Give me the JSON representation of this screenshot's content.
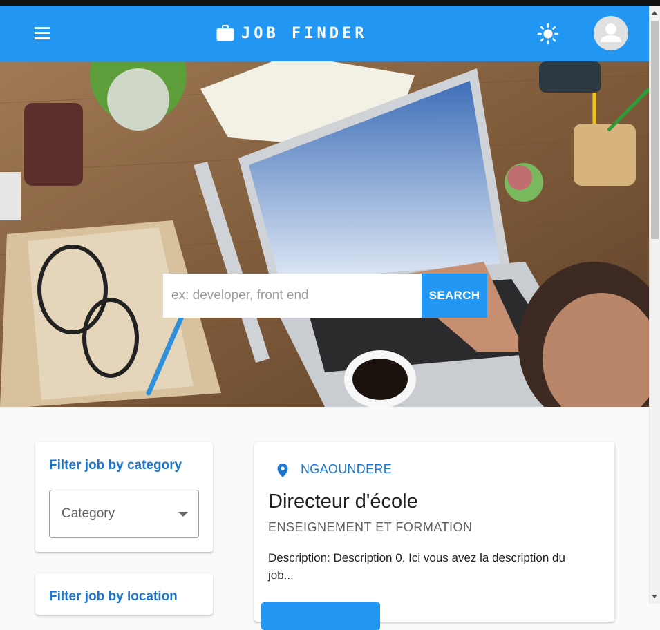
{
  "header": {
    "menu_icon": "menu-icon",
    "brand_icon": "briefcase-icon",
    "title": "JOB FINDER",
    "theme_icon": "sun-icon",
    "avatar_icon": "account-circle-icon",
    "color": "#2196f3"
  },
  "hero": {
    "image_subject": "Job Application",
    "search": {
      "placeholder": "ex: developer, front end",
      "value": "",
      "button_label": "SEARCH"
    }
  },
  "filters": {
    "category": {
      "title": "Filter job by category",
      "select_label": "Category",
      "dropdown_icon": "dropdown-arrow-icon"
    },
    "location": {
      "title": "Filter job by location"
    }
  },
  "jobs": [
    {
      "location_icon": "map-marker-icon",
      "location": "NGAOUNDERE",
      "title": "Directeur d'école",
      "category": "ENSEIGNEMENT ET FORMATION",
      "description": "Description: Description 0. Ici vous avez la description du job..."
    }
  ],
  "colors": {
    "primary": "#2196f3",
    "accent_text": "#1976d2",
    "background": "#fafafa"
  }
}
